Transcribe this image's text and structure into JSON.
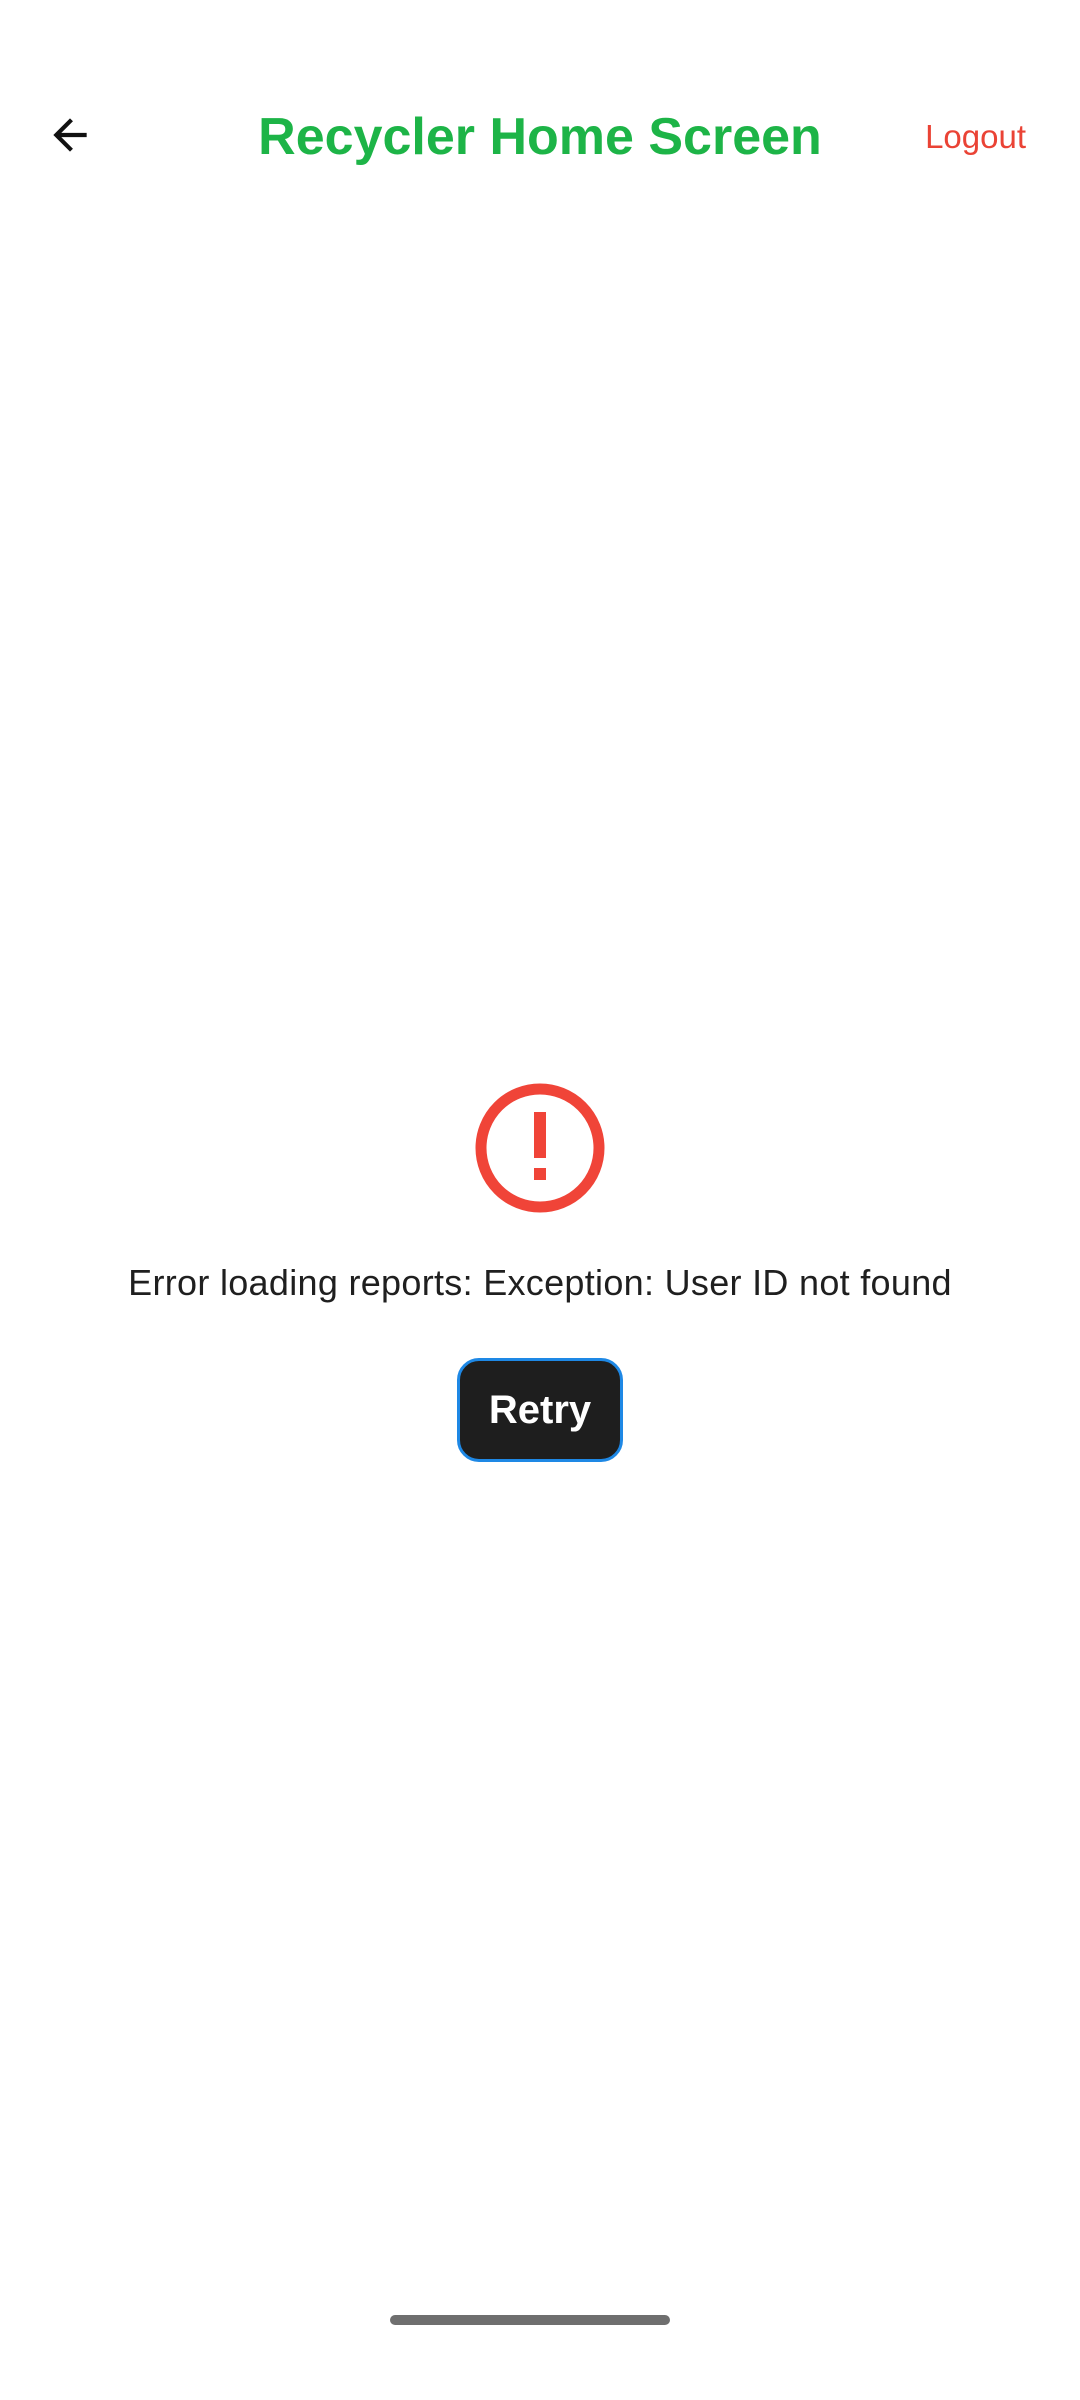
{
  "app_bar": {
    "title": "Recycler Home Screen",
    "back_icon": "arrow-back-icon",
    "logout_label": "Logout"
  },
  "error": {
    "icon": "error-outline-icon",
    "message": "Error loading reports: Exception: User ID not found",
    "retry_label": "Retry"
  },
  "colors": {
    "title_green": "#1db447",
    "logout_red": "#ea4335",
    "error_red": "#f04438",
    "button_dark": "#1e1e1e",
    "button_border_blue": "#1e88e5"
  }
}
